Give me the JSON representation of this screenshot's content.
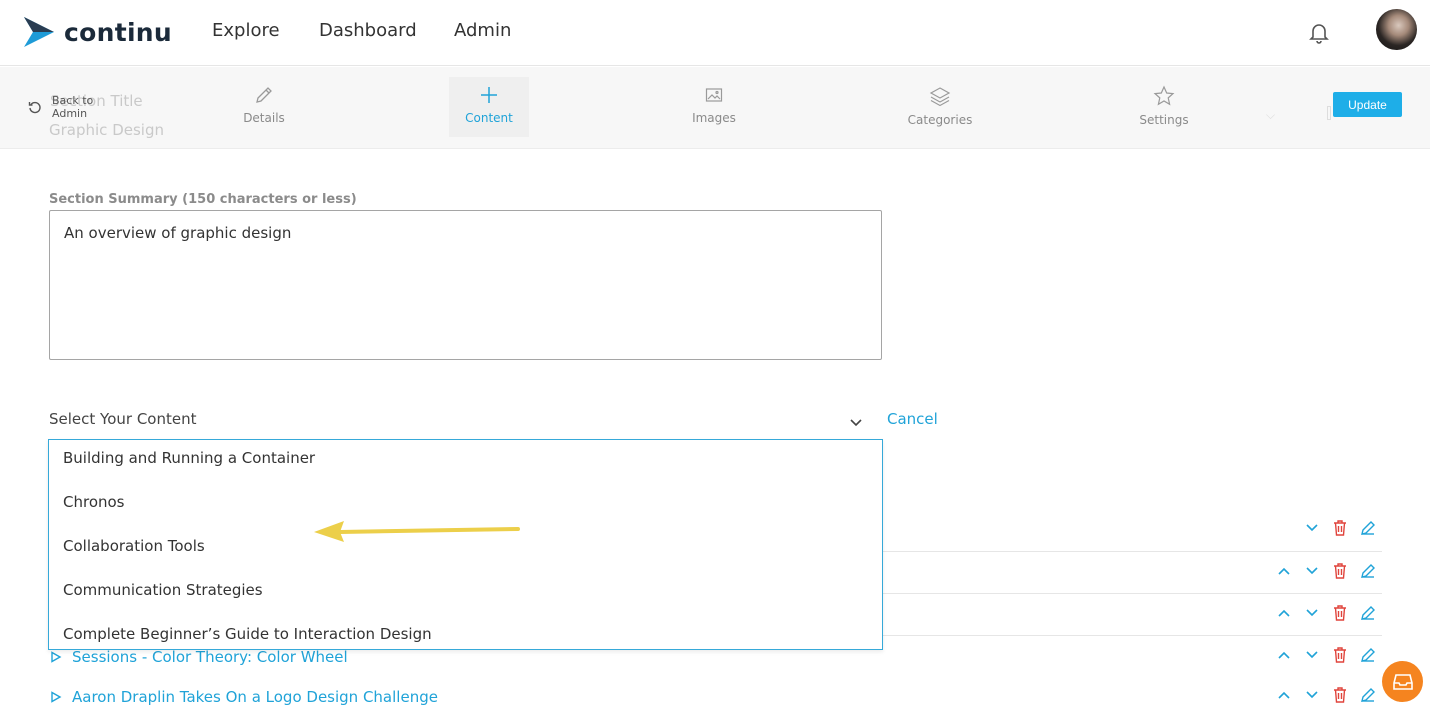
{
  "brand": {
    "name": "continu"
  },
  "nav": {
    "items": [
      "Explore",
      "Dashboard",
      "Admin"
    ]
  },
  "subnav": {
    "back_label": "Back to Admin",
    "ghost_title_label": "Section Title",
    "ghost_title_value": "Graphic Design",
    "tabs": [
      {
        "label": "Details",
        "icon": "pencil-icon"
      },
      {
        "label": "Content",
        "icon": "plus-icon"
      },
      {
        "label": "Images",
        "icon": "image-icon"
      },
      {
        "label": "Categories",
        "icon": "layers-icon"
      },
      {
        "label": "Settings",
        "icon": "star-icon"
      }
    ],
    "active_tab": "Content",
    "update_label": "Update"
  },
  "summary": {
    "label": "Section Summary (150 characters or less)",
    "value": "An overview of graphic design"
  },
  "content_select": {
    "placeholder": "Select Your Content",
    "cancel_label": "Cancel",
    "options": [
      "Building and Running a Container",
      "Chronos",
      "Collaboration Tools",
      "Communication Strategies",
      "Complete Beginner’s Guide to Interaction Design"
    ]
  },
  "content_list": {
    "items": [
      "Sessions - Color Theory: Color Wheel",
      "Aaron Draplin Takes On a Logo Design Challenge"
    ]
  },
  "colors": {
    "accent": "#20a3d8",
    "update_button": "#1eaee8",
    "delete": "#e0443c",
    "annotation_arrow": "#eccf4a",
    "fab": "#f5841f"
  }
}
